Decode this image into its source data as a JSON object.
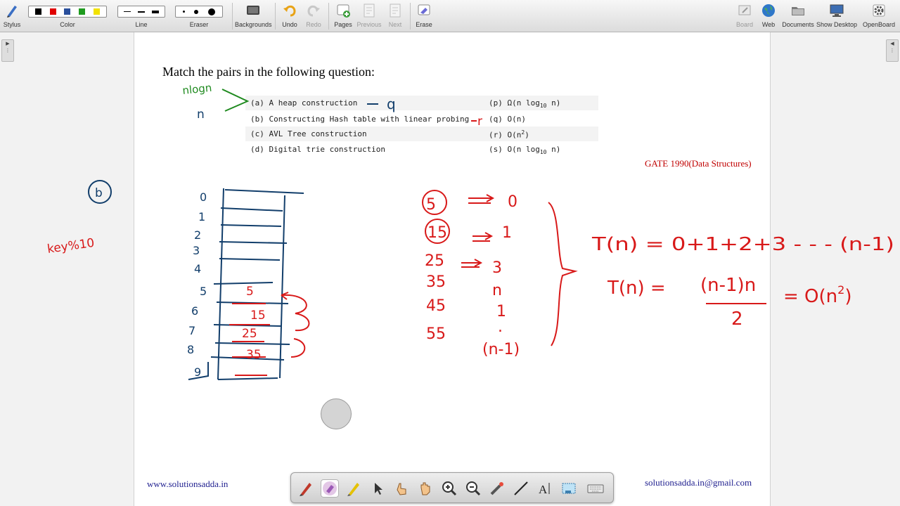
{
  "toolbar": {
    "stylus": "Stylus",
    "color": "Color",
    "line": "Line",
    "eraser": "Eraser",
    "backgrounds": "Backgrounds",
    "undo": "Undo",
    "redo": "Redo",
    "pages": "Pages",
    "previous": "Previous",
    "next": "Next",
    "erase": "Erase",
    "board": "Board",
    "web": "Web",
    "documents": "Documents",
    "show_desktop": "Show Desktop",
    "openboard": "OpenBoard"
  },
  "colors": {
    "palette": [
      "#000000",
      "#e00000",
      "#2a4f9c",
      "#1f9b1f",
      "#f2e200"
    ],
    "ink_red": "#d81919",
    "ink_blue": "#123e6b",
    "ink_green": "#1f8a1f",
    "source_red": "#c00000",
    "footer_blue": "#1f1f8f"
  },
  "page": {
    "title": "Match the pairs in the following question:",
    "questions": [
      {
        "left": "(a) A heap construction",
        "right": "(p) Ω(n log",
        "right_sub": "10",
        "right_tail": " n)"
      },
      {
        "left": "(b) Constructing Hash table with linear probing",
        "right": "(q) O(n)",
        "right_sub": "",
        "right_tail": ""
      },
      {
        "left": "(c) AVL Tree construction",
        "right": "(r) O(n",
        "right_sup": "2",
        "right_tail": ")"
      },
      {
        "left": "(d) Digital trie construction",
        "right": "(s) O(n log",
        "right_sub": "10",
        "right_tail": " n)"
      }
    ],
    "source": "GATE 1990(Data Structures)",
    "footer_left": "www.solutionsadda.in",
    "footer_right": "solutionsadda.in@gmail.com"
  },
  "annotations": {
    "answer_a": "q",
    "answer_b": "r",
    "nlogn_note": "nlogn",
    "n_note": "n",
    "part_label": "b",
    "key_note": "key%10",
    "slot_indices": [
      "0",
      "1",
      "2",
      "3",
      "4",
      "5",
      "6",
      "7",
      "8",
      "9"
    ],
    "stored_keys": [
      "5",
      "15",
      "25",
      "35"
    ],
    "keys_column": [
      "5",
      "15",
      "25",
      "35",
      "45",
      "55"
    ],
    "probe_counts": [
      "0",
      "1",
      "3",
      "n",
      "1",
      ".",
      "(n-1)"
    ],
    "eq1": "T(n) = 0+1+2+3 - - - (n-1)",
    "eq2_lhs": "T(n) =",
    "eq2_num": "(n-1)n",
    "eq2_den": "2",
    "eq2_rhs": "= O(n",
    "eq2_sup": "2",
    "eq2_tail": ")"
  }
}
